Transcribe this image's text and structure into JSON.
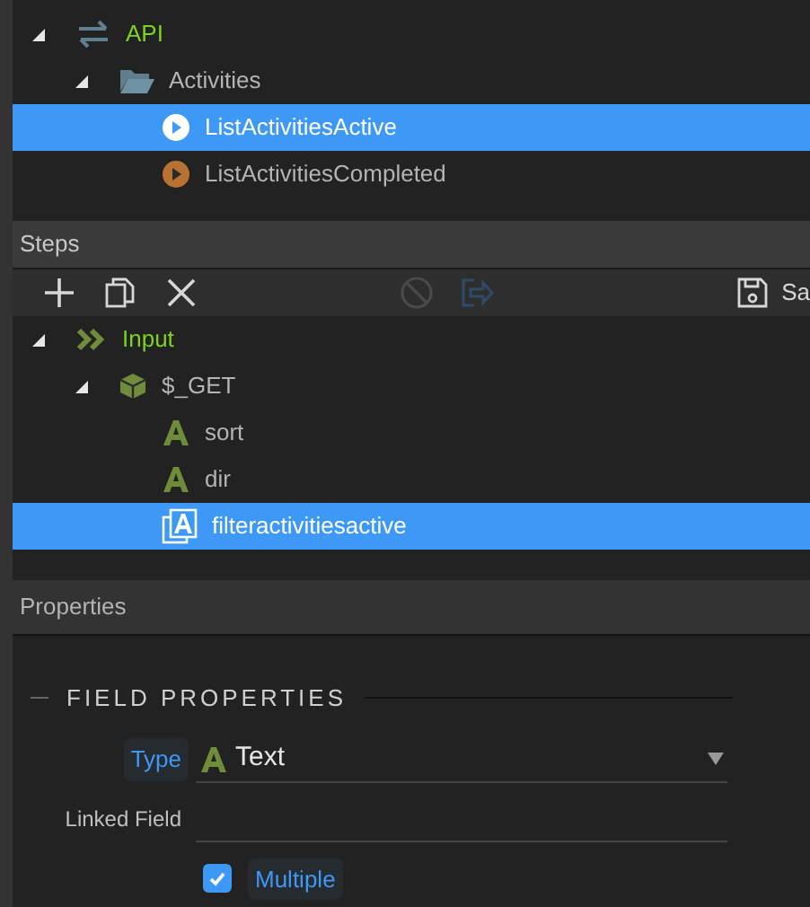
{
  "top_tree": [
    {
      "label": "API",
      "kind": "api",
      "expanded": true,
      "selected": false,
      "children": [
        {
          "label": "Activities",
          "kind": "folder",
          "expanded": true,
          "selected": false,
          "children": [
            {
              "label": "ListActivitiesActive",
              "kind": "action",
              "selected": true
            },
            {
              "label": "ListActivitiesCompleted",
              "kind": "action",
              "selected": false
            }
          ]
        }
      ]
    }
  ],
  "steps": {
    "title": "Steps",
    "toolbar": [
      {
        "kind": "add",
        "disabled": false
      },
      {
        "kind": "copy",
        "disabled": false
      },
      {
        "kind": "delete",
        "disabled": false
      },
      {
        "kind": "disable",
        "disabled": true
      },
      {
        "kind": "export",
        "disabled": true
      },
      {
        "kind": "save",
        "disabled": false,
        "label": "Sa"
      }
    ],
    "tree": [
      {
        "label": "Input",
        "kind": "input",
        "expanded": true,
        "selected": false,
        "children": [
          {
            "label": "$_GET",
            "kind": "object",
            "expanded": true,
            "selected": false,
            "children": [
              {
                "label": "sort",
                "kind": "text",
                "selected": false
              },
              {
                "label": "dir",
                "kind": "text",
                "selected": false
              },
              {
                "label": "filteractivitiesactive",
                "kind": "text-multiple",
                "selected": true
              }
            ]
          }
        ]
      }
    ]
  },
  "properties": {
    "title": "Properties",
    "section": "FIELD PROPERTIES",
    "type": {
      "label": "Type",
      "value": "Text"
    },
    "linked_field": {
      "label": "Linked Field"
    },
    "multiple": {
      "label": "Multiple",
      "checked": true
    }
  }
}
